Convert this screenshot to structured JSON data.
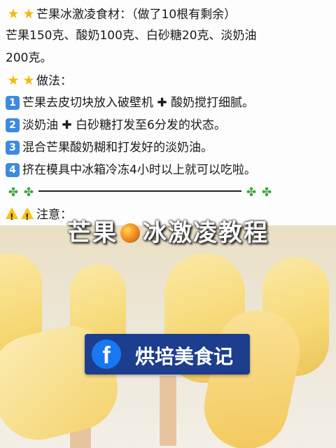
{
  "recipe": {
    "ingredients_title": "芒果冰激凌食材：（做了10根有剩余）",
    "ingredients_line1": "芒果150克、酸奶100克、白砂糖20克、淡奶油",
    "ingredients_line2": "200克。",
    "method_title": "做法：",
    "steps": [
      {
        "num": "1",
        "text_a": "芒果去皮切块放入破壁机",
        "text_b": "酸奶搅打细腻。"
      },
      {
        "num": "2",
        "text_a": "淡奶油",
        "text_b": "白砂糖打发至6分发的状态。"
      },
      {
        "num": "3",
        "text_a": "混合芒果酸奶糊和打发好的淡奶油。",
        "text_b": ""
      },
      {
        "num": "4",
        "text_a": "挤在模具中冰箱冷冻4小时以上就可以吃啦。",
        "text_b": ""
      }
    ],
    "notes_title": "注意："
  },
  "banner": {
    "part1": "芒果",
    "part2": "冰激凌教程"
  },
  "badge": {
    "logo_letter": "f",
    "name": "烘培美食记"
  },
  "icons": {
    "star": "star-icon",
    "plus": "plus-icon",
    "clover": "four-leaf-clover-icon",
    "warning": "warning-icon",
    "mango": "mango-icon",
    "facebook": "facebook-logo-icon"
  },
  "colors": {
    "star": "#f5b90a",
    "number_box": "#3d8be0",
    "badge": "#1d3e8e",
    "facebook": "#1877f2"
  }
}
